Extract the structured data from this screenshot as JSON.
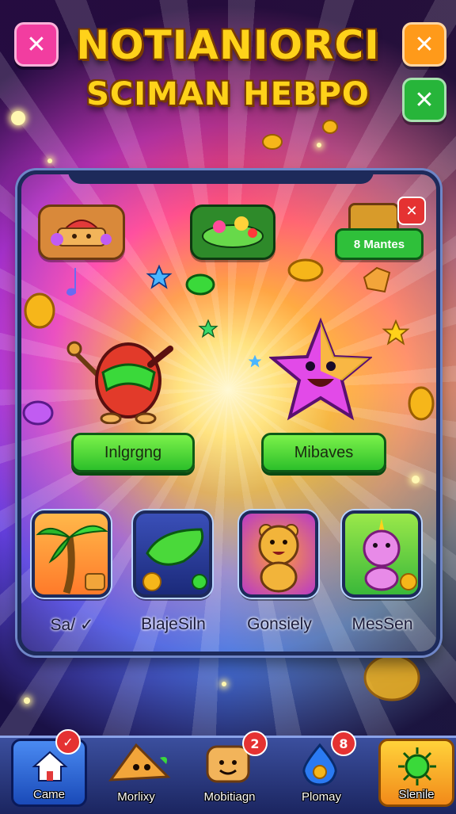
{
  "header": {
    "title_line1": "NOTIANIORCI",
    "title_line2": "SCIMAN HEBPO",
    "left_button_icon": "close-icon",
    "right_top_button_icon": "close-icon",
    "right_second_button_icon": "close-icon"
  },
  "panel": {
    "counter_label": "8 Mantes",
    "close_icon": "close-icon",
    "buttons": [
      {
        "label": "Inlgrgng"
      },
      {
        "label": "Mibaves"
      }
    ],
    "tiles": [
      {
        "label": "Sa/ ✓",
        "icon": "palm-tree-icon"
      },
      {
        "label": "BlajeSiln",
        "icon": "pickle-icon"
      },
      {
        "label": "Gonsiely",
        "icon": "bear-icon"
      },
      {
        "label": "MesSen",
        "icon": "unicorn-icon"
      }
    ]
  },
  "bottom_nav": {
    "items": [
      {
        "label": "Came",
        "icon": "house-icon",
        "badge": "✓"
      },
      {
        "label": "Morlixy",
        "icon": "cheese-icon",
        "badge": ""
      },
      {
        "label": "Mobitiagn",
        "icon": "toast-icon",
        "badge": "2"
      },
      {
        "label": "Plomay",
        "icon": "droplet-icon",
        "badge": "8"
      },
      {
        "label": "Slenile",
        "icon": "sun-icon",
        "badge": ""
      }
    ]
  },
  "colors": {
    "accent_green": "#2cbf2a",
    "title_yellow": "#ffd21a",
    "close_pink": "#f23da0",
    "close_orange": "#ff9a1a",
    "close_green": "#27b53a",
    "badge_red": "#e53232",
    "panel_border": "#1d2a5a"
  }
}
